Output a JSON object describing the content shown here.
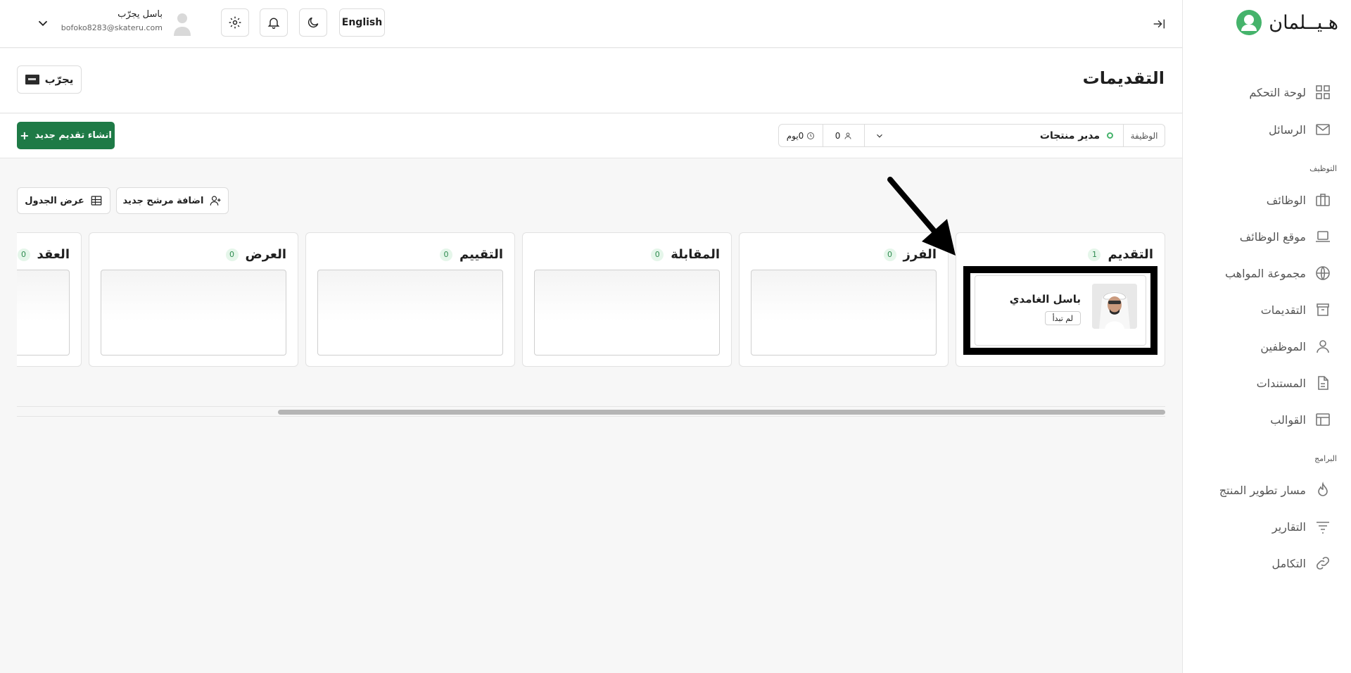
{
  "brand": {
    "name": "هـيــلمان"
  },
  "sidebar": {
    "items": [
      {
        "label": "لوحة التحكم",
        "icon": "dashboard-icon"
      },
      {
        "label": "الرسائل",
        "icon": "mail-icon"
      },
      {
        "label": "الوظائف",
        "icon": "briefcase-icon"
      },
      {
        "label": "موقع الوظائف",
        "icon": "laptop-icon"
      },
      {
        "label": "مجموعة المواهب",
        "icon": "talent-pool-icon"
      },
      {
        "label": "التقديمات",
        "icon": "applications-icon"
      },
      {
        "label": "الموظفين",
        "icon": "user-icon"
      },
      {
        "label": "المستندات",
        "icon": "document-icon"
      },
      {
        "label": "القوالب",
        "icon": "template-icon"
      },
      {
        "label": "مسار تطوير المنتج",
        "icon": "flame-icon"
      },
      {
        "label": "التقارير",
        "icon": "filter-lines-icon"
      },
      {
        "label": "التكامل",
        "icon": "link-icon"
      }
    ],
    "sections": {
      "hiring": "التوظيف",
      "programs": "البرامج"
    }
  },
  "topbar": {
    "language_label": "English",
    "user_name": "باسل يجرّب",
    "user_email": "bofoko8283@skateru.com"
  },
  "header": {
    "title": "التقديمات",
    "test_button_label": "يجرّب"
  },
  "filter": {
    "job_label": "الوظيفة",
    "job_value": "مدير منتجات",
    "applicant_count": "0",
    "days_label": "0يوم",
    "create_label": "انشاء تقديم جديد"
  },
  "actions": {
    "add_candidate": "اضافة مرشح جديد",
    "table_view": "عرض الجدول"
  },
  "board": {
    "columns": [
      {
        "title": "التقديم",
        "count": "1"
      },
      {
        "title": "الفرز",
        "count": "0"
      },
      {
        "title": "المقابلة",
        "count": "0"
      },
      {
        "title": "التقييم",
        "count": "0"
      },
      {
        "title": "العرض",
        "count": "0"
      },
      {
        "title": "العقد",
        "count": "0"
      }
    ],
    "candidate": {
      "name": "باسل الغامدي",
      "status": "لم تبدأ"
    }
  },
  "colors": {
    "accent": "#1e7a46",
    "brand": "#45b36b",
    "badge_bg": "#e5f6ea"
  }
}
